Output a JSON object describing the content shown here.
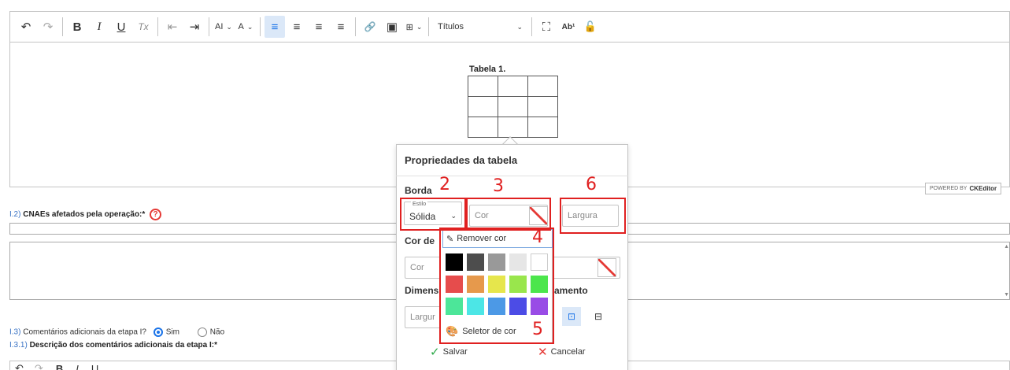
{
  "toolbar": {
    "undo_icon": "↶",
    "redo_icon": "↷",
    "bold": "B",
    "italic": "I",
    "underline": "U",
    "clear_format": "Tx",
    "outdent_icon": "⇤",
    "indent_icon": "⇥",
    "font_size": "AI",
    "font_family": "A",
    "align_left": "≡",
    "align_right": "≡",
    "align_center": "≡",
    "align_justify": "≡",
    "link_icon": "🔗",
    "image_icon": "▣",
    "table_icon": "⊞",
    "headings": "Títulos",
    "fullscreen_icon": "⛶",
    "superscript": "Ab¹",
    "lock_icon": "🔓"
  },
  "editor": {
    "table_caption": "Tabela 1.",
    "powered_by": "POWERED BY",
    "ckeditor": "CKEditor"
  },
  "form": {
    "q2_num": "I.2)",
    "q2_label": "CNAEs afetados pela operação:*",
    "q3_num": "I.3)",
    "q3_label": "Comentários adicionais da etapa I?",
    "q3_yes": "Sim",
    "q3_no": "Não",
    "q31_num": "I.3.1)",
    "q31_label": "Descrição dos comentários adicionais da etapa I:*"
  },
  "panel": {
    "title": "Propriedades da tabela",
    "border_label": "Borda",
    "style_label": "Estilo",
    "style_value": "Sólida",
    "color_placeholder": "Cor",
    "width_placeholder": "Largura",
    "bg_label_partial": "Cor de",
    "bg_color_placeholder": "Cor",
    "dim_label_partial": "Dimens",
    "align_label_partial": "amento",
    "dim_width_partial": "Largur",
    "remove_color": "Remover cor",
    "color_picker": "Seletor de cor",
    "save": "Salvar",
    "cancel": "Cancelar",
    "palette": [
      "#000000",
      "#4d4d4d",
      "#999999",
      "#e6e6e6",
      "#ffffff",
      "#e64c4c",
      "#e6994c",
      "#e6e64c",
      "#99e64c",
      "#4ce64c",
      "#4ce699",
      "#4ce6e6",
      "#4c99e6",
      "#4c4ce6",
      "#994ce6"
    ]
  },
  "annotations": [
    "2",
    "3",
    "4",
    "5",
    "6"
  ]
}
